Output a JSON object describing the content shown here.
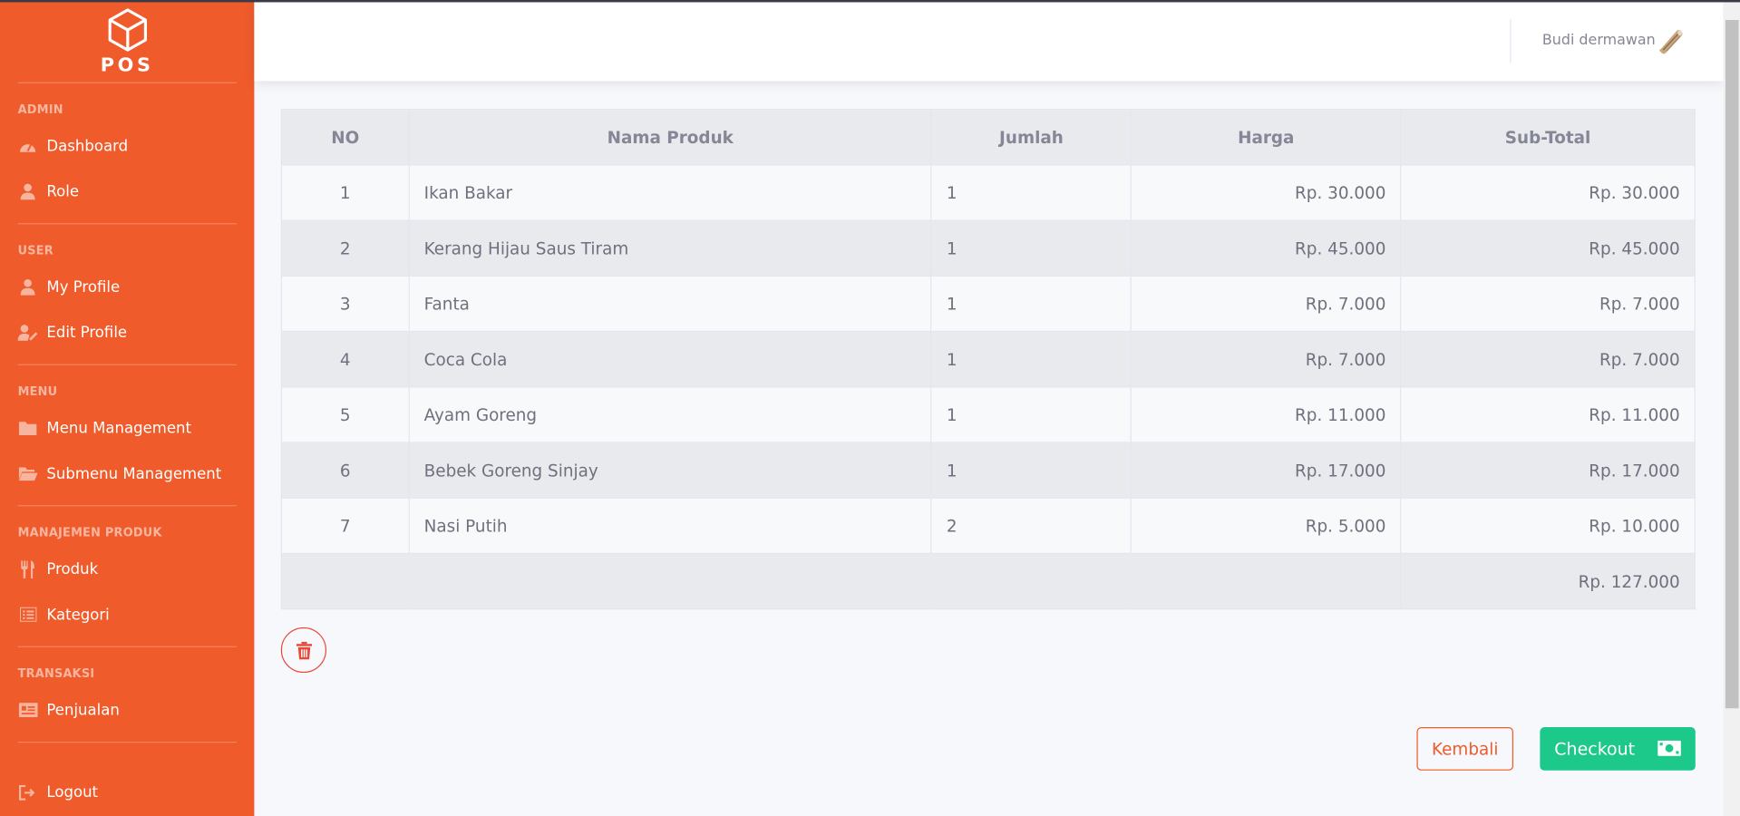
{
  "brand": {
    "name": "POS",
    "icon": "cube-icon"
  },
  "sidebar": {
    "sections": [
      {
        "heading": "ADMIN",
        "items": [
          {
            "label": "Dashboard",
            "icon": "speedometer-icon"
          },
          {
            "label": "Role",
            "icon": "user-icon"
          }
        ]
      },
      {
        "heading": "USER",
        "items": [
          {
            "label": "My Profile",
            "icon": "user-icon"
          },
          {
            "label": "Edit Profile",
            "icon": "user-edit-icon"
          }
        ]
      },
      {
        "heading": "MENU",
        "items": [
          {
            "label": "Menu Management",
            "icon": "folder-icon"
          },
          {
            "label": "Submenu Management",
            "icon": "folder-open-icon"
          }
        ]
      },
      {
        "heading": "MANAJEMEN PRODUK",
        "items": [
          {
            "label": "Produk",
            "icon": "utensils-icon"
          },
          {
            "label": "Kategori",
            "icon": "list-icon"
          }
        ]
      },
      {
        "heading": "TRANSAKSI",
        "items": [
          {
            "label": "Penjualan",
            "icon": "receipt-icon"
          }
        ]
      }
    ],
    "logout": "Logout"
  },
  "topbar": {
    "user_name": "Budi dermawan",
    "avatar_icon": "avatar-icon"
  },
  "table": {
    "headers": [
      "NO",
      "Nama Produk",
      "Jumlah",
      "Harga",
      "Sub-Total"
    ],
    "rows": [
      {
        "no": "1",
        "name": "Ikan Bakar",
        "qty": "1",
        "price": "Rp. 30.000",
        "subtotal": "Rp. 30.000"
      },
      {
        "no": "2",
        "name": "Kerang Hijau Saus Tiram",
        "qty": "1",
        "price": "Rp. 45.000",
        "subtotal": "Rp. 45.000"
      },
      {
        "no": "3",
        "name": "Fanta",
        "qty": "1",
        "price": "Rp. 7.000",
        "subtotal": "Rp. 7.000"
      },
      {
        "no": "4",
        "name": "Coca Cola",
        "qty": "1",
        "price": "Rp. 7.000",
        "subtotal": "Rp. 7.000"
      },
      {
        "no": "5",
        "name": "Ayam Goreng",
        "qty": "1",
        "price": "Rp. 11.000",
        "subtotal": "Rp. 11.000"
      },
      {
        "no": "6",
        "name": "Bebek Goreng Sinjay",
        "qty": "1",
        "price": "Rp. 17.000",
        "subtotal": "Rp. 17.000"
      },
      {
        "no": "7",
        "name": "Nasi Putih",
        "qty": "2",
        "price": "Rp. 5.000",
        "subtotal": "Rp. 10.000"
      }
    ],
    "total": "Rp. 127.000"
  },
  "actions": {
    "clear_icon": "trash-icon",
    "back_label": "Kembali",
    "checkout_label": "Checkout",
    "checkout_icon": "money-bill-icon"
  },
  "colors": {
    "sidebar": "#ef5b2b",
    "checkout": "#1cc88a",
    "danger": "#e74a3b"
  }
}
